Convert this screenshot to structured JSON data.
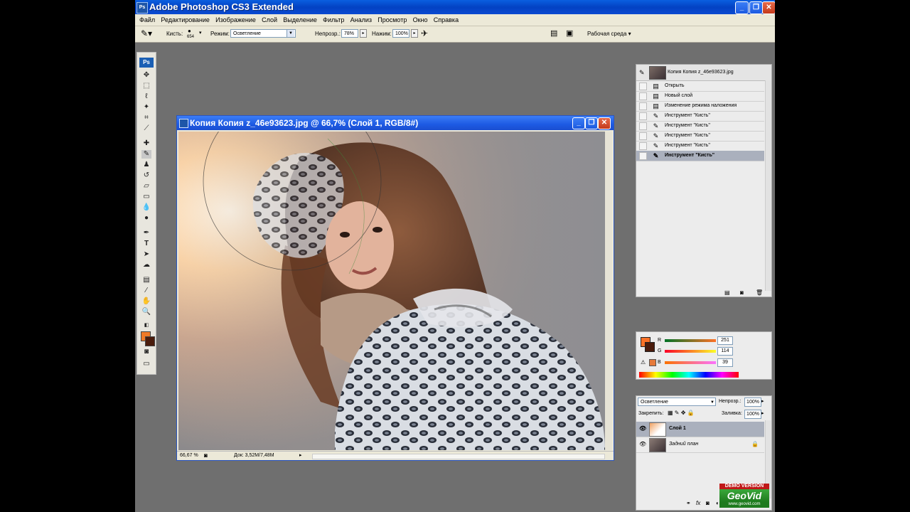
{
  "app": {
    "title": "Adobe Photoshop CS3 Extended",
    "ps_badge": "Ps"
  },
  "menu": [
    "Файл",
    "Редактирование",
    "Изображение",
    "Слой",
    "Выделение",
    "Фильтр",
    "Анализ",
    "Просмотр",
    "Окно",
    "Справка"
  ],
  "options": {
    "brush_label": "Кисть:",
    "brush_size": "654",
    "mode_label": "Режим:",
    "mode_value": "Осветление",
    "opacity_label": "Непрозр.:",
    "opacity_value": "78%",
    "flow_label": "Нажим:",
    "flow_value": "100%",
    "workspace_label": "Рабочая среда"
  },
  "document": {
    "title": "Копия Копия z_46e93623.jpg @ 66,7% (Слой 1, RGB/8#)",
    "zoom": "66,67 %",
    "doc_size": "Док: 3,52M/7,48M"
  },
  "history": {
    "snapshot": "Копия Копия z_46e93623.jpg",
    "items": [
      {
        "label": "Открыть",
        "icon": "doc-icon"
      },
      {
        "label": "Новый слой",
        "icon": "doc-icon"
      },
      {
        "label": "Изменение режима наложения",
        "icon": "doc-icon"
      },
      {
        "label": "Инструмент \"Кисть\"",
        "icon": "brush-icon"
      },
      {
        "label": "Инструмент \"Кисть\"",
        "icon": "brush-icon"
      },
      {
        "label": "Инструмент \"Кисть\"",
        "icon": "brush-icon"
      },
      {
        "label": "Инструмент \"Кисть\"",
        "icon": "brush-icon"
      },
      {
        "label": "Инструмент \"Кисть\"",
        "icon": "brush-icon",
        "selected": true
      }
    ]
  },
  "color": {
    "r_label": "R",
    "r_value": "251",
    "g_label": "G",
    "g_value": "114",
    "b_label": "B",
    "b_value": "39",
    "foreground": "#fb7227",
    "background": "#4a1c0c"
  },
  "layers": {
    "blend_mode": "Осветление",
    "opacity_label": "Непрозр.:",
    "opacity_value": "100%",
    "lock_label": "Закрепить:",
    "fill_label": "Заливка:",
    "fill_value": "100%",
    "items": [
      {
        "name": "Слой 1",
        "selected": true
      },
      {
        "name": "Задний план",
        "selected": false,
        "locked": true
      }
    ]
  },
  "watermark": {
    "demo": "DEMO VERSION",
    "brand": "GeoVid",
    "url": "www.geovid.com"
  }
}
